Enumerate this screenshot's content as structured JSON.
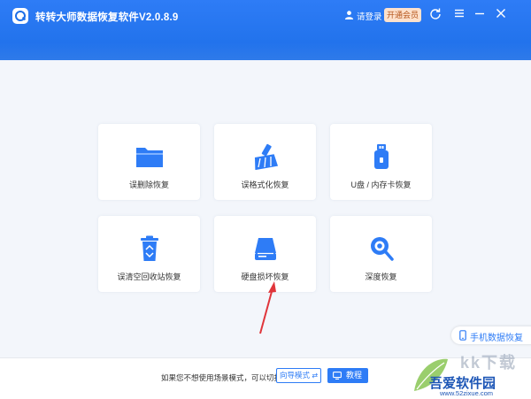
{
  "app": {
    "title": "转转大师数据恢复软件V2.0.8.9"
  },
  "header": {
    "login_label": "请登录",
    "vip_label": "开通会员",
    "icons": [
      "user-icon",
      "update-icon",
      "menu-icon",
      "minimize-icon",
      "close-icon"
    ]
  },
  "colors": {
    "brand": "#2e7cf6",
    "header_bg": "#1d6fe8",
    "vip_bg": "#fde1cc",
    "vip_text": "#b5541a",
    "arrow": "#e0353b"
  },
  "cards": [
    {
      "label": "误删除恢复",
      "icon": "folder-icon"
    },
    {
      "label": "误格式化恢复",
      "icon": "broom-icon"
    },
    {
      "label": "U盘 / 内存卡恢复",
      "icon": "usb-card-icon"
    },
    {
      "label": "误清空回收站恢复",
      "icon": "recycle-bin-icon"
    },
    {
      "label": "硬盘损坏恢复",
      "icon": "hard-disk-icon"
    },
    {
      "label": "深度恢复",
      "icon": "deep-scan-icon"
    }
  ],
  "phone_tab": {
    "label": "手机数据恢复"
  },
  "footer": {
    "text": "如果您不想使用场景模式，可以切换至",
    "wizard_label": "向导模式",
    "tutorial_label": "教程"
  },
  "watermark": {
    "title": "吾爱软件园",
    "url": "www.52zixue.com",
    "overlay": "kk下载"
  }
}
